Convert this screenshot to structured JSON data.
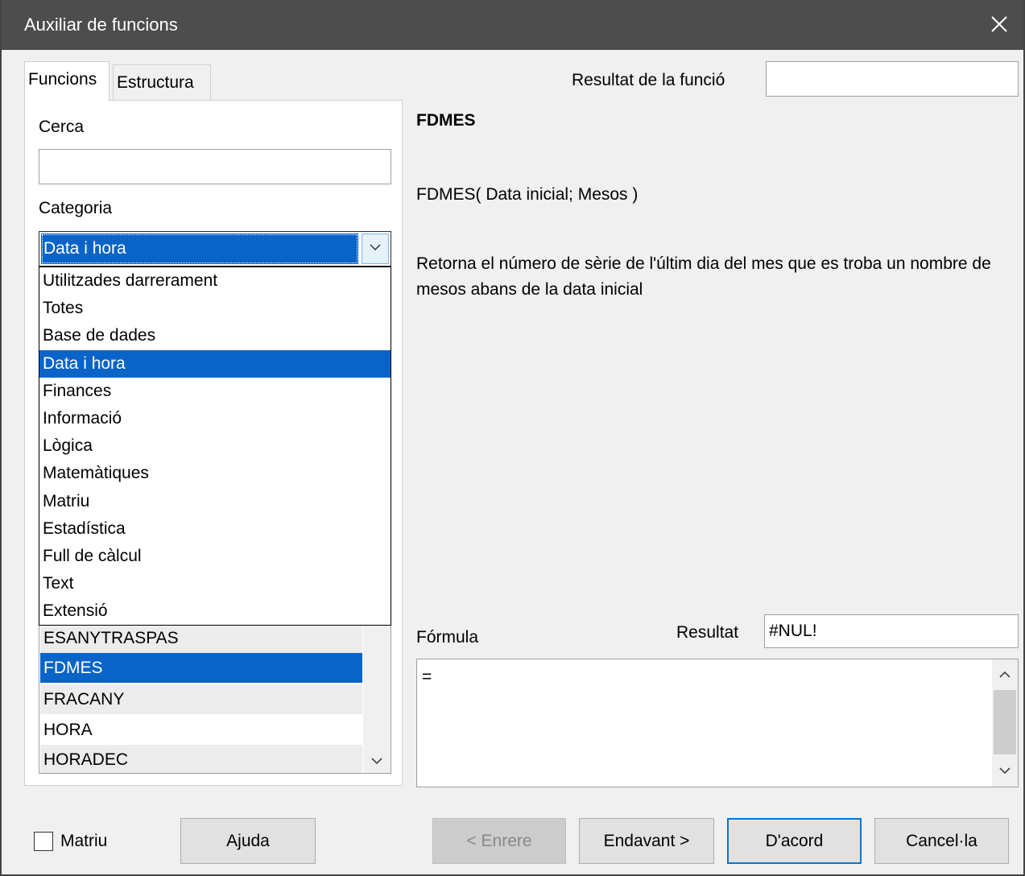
{
  "window": {
    "title": "Auxiliar de funcions"
  },
  "tabs": [
    {
      "label": "Funcions"
    },
    {
      "label": "Estructura"
    }
  ],
  "search": {
    "label": "Cerca",
    "value": ""
  },
  "category": {
    "label": "Categoria",
    "selected": "Data i hora",
    "options": [
      "Utilitzades darrerament",
      "Totes",
      "Base de dades",
      "Data i hora",
      "Finances",
      "Informació",
      "Lògica",
      "Matemàtiques",
      "Matriu",
      "Estadística",
      "Full de càlcul",
      "Text",
      "Extensió"
    ]
  },
  "function_list": {
    "items": [
      "ESANYTRASPAS",
      "FDMES",
      "FRACANY",
      "HORA",
      "HORADEC"
    ],
    "selected": "FDMES"
  },
  "function_result": {
    "label": "Resultat de la funció",
    "value": ""
  },
  "function_info": {
    "name": "FDMES",
    "syntax": "FDMES( Data inicial; Mesos )",
    "description": "Retorna el número de sèrie de l'últim dia del mes que es troba un nombre de mesos abans de la data inicial"
  },
  "formula": {
    "label": "Fórmula",
    "value": "="
  },
  "result": {
    "label": "Resultat",
    "value": "#NUL!"
  },
  "footer": {
    "array_label": "Matriu",
    "array_checked": false,
    "help": "Ajuda",
    "back": "< Enrere",
    "next": "Endavant >",
    "ok": "D'acord",
    "cancel": "Cancel·la"
  },
  "colors": {
    "selection": "#0a64c8",
    "titlebar": "#4d4d4d",
    "default_button_border": "#0078d7"
  }
}
